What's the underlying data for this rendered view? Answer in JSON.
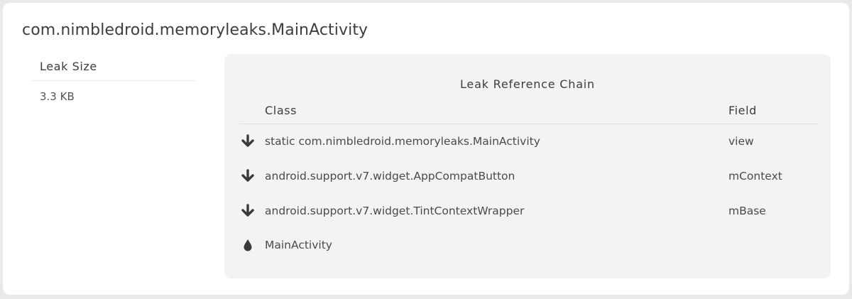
{
  "page": {
    "title": "com.nimbledroid.memoryleaks.MainActivity"
  },
  "leak_size": {
    "header": "Leak Size",
    "value": "3.3 KB"
  },
  "chain": {
    "title": "Leak Reference Chain",
    "columns": {
      "class": "Class",
      "field": "Field"
    },
    "rows": [
      {
        "icon": "arrow-down-icon",
        "class": "static com.nimbledroid.memoryleaks.MainActivity",
        "field": "view"
      },
      {
        "icon": "arrow-down-icon",
        "class": "android.support.v7.widget.AppCompatButton",
        "field": "mContext"
      },
      {
        "icon": "arrow-down-icon",
        "class": "android.support.v7.widget.TintContextWrapper",
        "field": "mBase"
      },
      {
        "icon": "drop-icon",
        "class": "MainActivity",
        "field": ""
      }
    ]
  },
  "colors": {
    "page_bg": "#e9e9e9",
    "card_bg": "#ffffff",
    "panel_bg": "#f3f3f3",
    "text": "#4a4a4a",
    "icon": "#3a3a3a"
  }
}
